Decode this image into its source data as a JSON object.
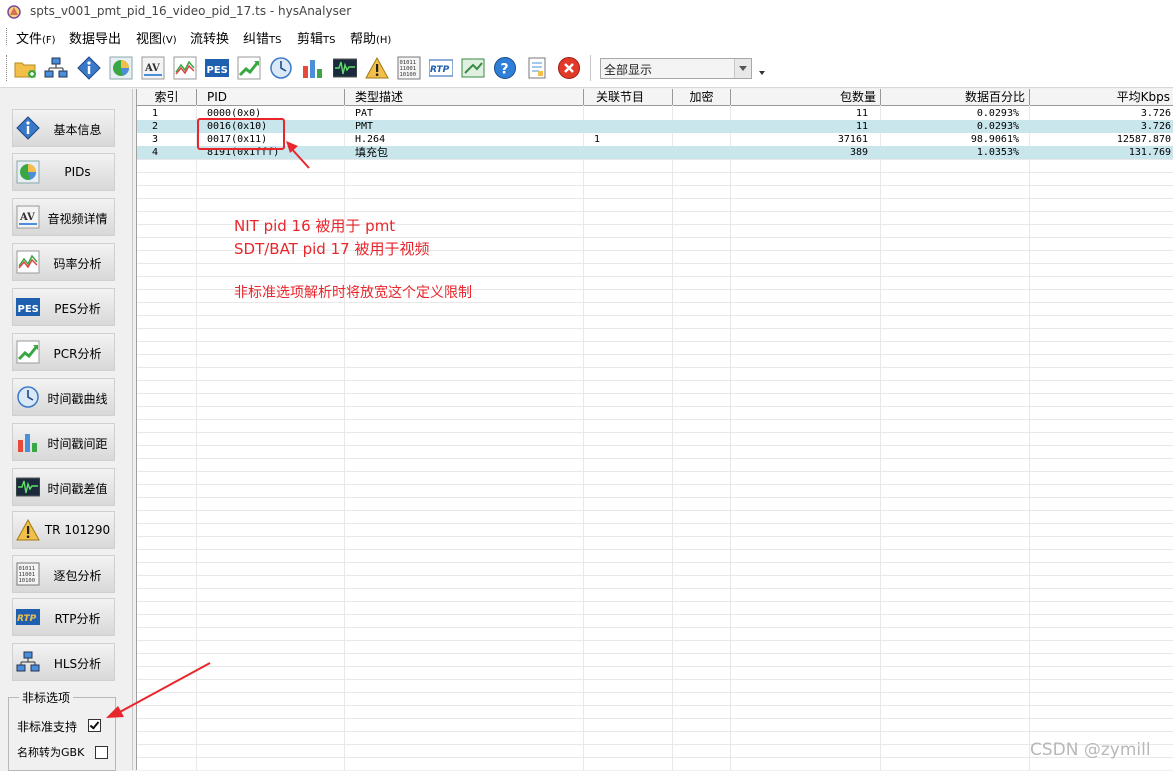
{
  "window": {
    "title": "spts_v001_pmt_pid_16_video_pid_17.ts - hysAnalyser"
  },
  "menu": [
    {
      "label": "文件",
      "acc": "(F)"
    },
    {
      "label": "数据导出",
      "acc": ""
    },
    {
      "label": "视图",
      "acc": "(V)"
    },
    {
      "label": "流转换",
      "acc": ""
    },
    {
      "label": "纠错",
      "acc": "TS"
    },
    {
      "label": "剪辑",
      "acc": "TS"
    },
    {
      "label": "帮助",
      "acc": "(H)"
    }
  ],
  "toolbar": {
    "icons": [
      "open-icon",
      "network-icon",
      "info-icon",
      "pie-icon",
      "av-icon",
      "rate-chart-icon",
      "pes-icon",
      "pcr-icon",
      "clock-icon",
      "bar-chart-icon",
      "wave-icon",
      "warning-icon",
      "binary-icon",
      "rtp-icon",
      "export-icon",
      "help-icon",
      "notes-icon",
      "close-icon"
    ],
    "filter": {
      "value": "全部显示"
    }
  },
  "sidebar": {
    "items": [
      {
        "label": "基本信息",
        "icon": "info-icon"
      },
      {
        "label": "PIDs",
        "icon": "pie-icon"
      },
      {
        "label": "音视频详情",
        "icon": "av-icon"
      },
      {
        "label": "码率分析",
        "icon": "rate-chart-icon"
      },
      {
        "label": "PES分析",
        "icon": "pes-icon"
      },
      {
        "label": "PCR分析",
        "icon": "pcr-icon"
      },
      {
        "label": "时间戳曲线",
        "icon": "clock-icon"
      },
      {
        "label": "时间戳间距",
        "icon": "bar-chart-icon"
      },
      {
        "label": "时间戳差值",
        "icon": "wave-icon"
      },
      {
        "label": "TR 101290",
        "icon": "warning-icon"
      },
      {
        "label": "逐包分析",
        "icon": "binary-icon"
      },
      {
        "label": "RTP分析",
        "icon": "rtp-icon"
      },
      {
        "label": "HLS分析",
        "icon": "network-icon"
      }
    ],
    "options": {
      "title": "非标选项",
      "nonstandard": {
        "label": "非标准支持",
        "checked": true
      },
      "gbk": {
        "label": "名称转为GBK",
        "checked": false
      }
    }
  },
  "table": {
    "columns": [
      "索引",
      "PID",
      "类型描述",
      "关联节目",
      "加密",
      "包数量",
      "数据百分比",
      "平均Kbps"
    ],
    "rows": [
      [
        "1",
        "0000(0x0)",
        "PAT",
        "",
        "",
        "11",
        "0.0293%",
        "3.726"
      ],
      [
        "2",
        "0016(0x10)",
        "PMT",
        "",
        "",
        "11",
        "0.0293%",
        "3.726"
      ],
      [
        "3",
        "0017(0x11)",
        "H.264",
        "1",
        "",
        "37161",
        "98.9061%",
        "12587.870"
      ],
      [
        "4",
        "8191(0x1fff)",
        "填充包",
        "",
        "",
        "389",
        "1.0353%",
        "131.769"
      ]
    ]
  },
  "annotations": {
    "line1": "NIT pid 16 被用于 pmt",
    "line2": "SDT/BAT pid 17 被用于视频",
    "line3": "非标准选项解析时将放宽这个定义限制",
    "color": "#e8262b"
  },
  "watermark": "CSDN @zymill"
}
